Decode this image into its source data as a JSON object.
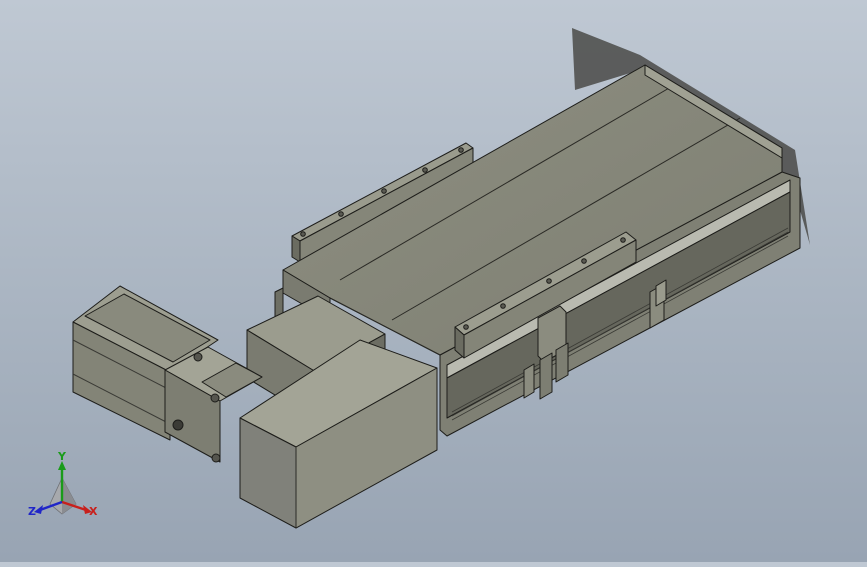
{
  "viewport": {
    "background_top": "#bfc8d3",
    "background_bottom": "#98a4b3",
    "model_color": "#8f8f80",
    "edge_color": "#1d1d1a"
  },
  "triad": {
    "x_label": "X",
    "y_label": "Y",
    "z_label": "Z",
    "x_color": "#c8201c",
    "y_color": "#1a9b1a",
    "z_color": "#2026c8"
  }
}
